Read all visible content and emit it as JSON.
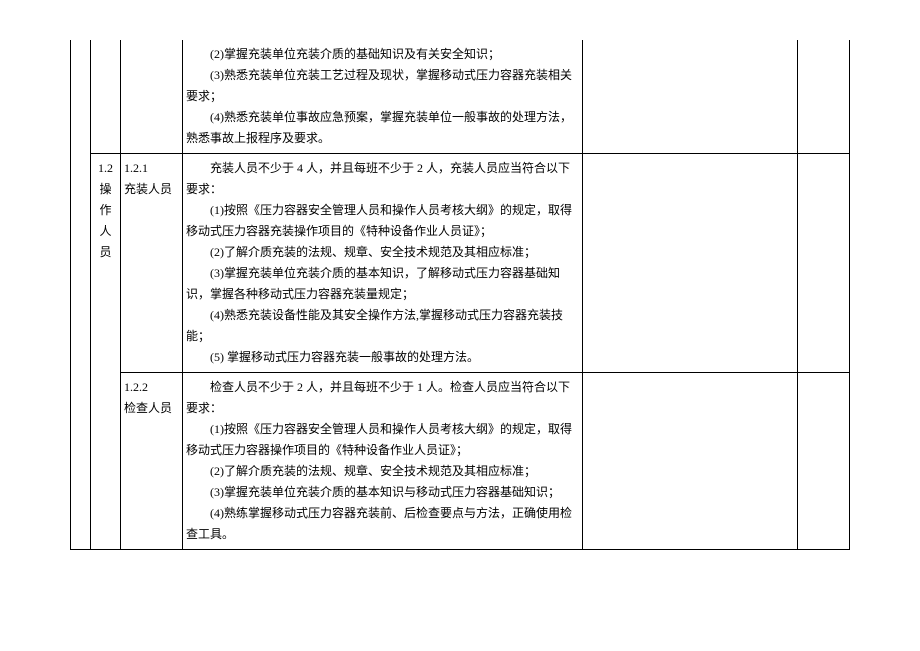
{
  "rows": {
    "r0": {
      "c3_p1": "(2)掌握充装单位充装介质的基础知识及有关安全知识；",
      "c3_p2": "(3)熟悉充装单位充装工艺过程及现状，掌握移动式压力容器充装相关要求；",
      "c3_p3": "(4)熟悉充装单位事故应急预案，掌握充装单位一般事故的处理方法，熟悉事故上报程序及要求。"
    },
    "r1": {
      "c1_l1": "1.2",
      "c1_l2": "操作人员",
      "c2_l1": "1.2.1",
      "c2_l2": "充装人员",
      "c3_p1": "充装人员不少于 4 人，并且每班不少于 2 人，充装人员应当符合以下要求：",
      "c3_p2": "(1)按照《压力容器安全管理人员和操作人员考核大纲》的规定，取得移动式压力容器充装操作项目的《特种设备作业人员证》；",
      "c3_p3": "(2)了解介质充装的法规、规章、安全技术规范及其相应标准；",
      "c3_p4": "(3)掌握充装单位充装介质的基本知识，了解移动式压力容器基础知识，掌握各种移动式压力容器充装量规定；",
      "c3_p5": "(4)熟悉充装设备性能及其安全操作方法,掌握移动式压力容器充装技能；",
      "c3_p6": "(5) 掌握移动式压力容器充装一般事故的处理方法。"
    },
    "r2": {
      "c2_l1": "1.2.2",
      "c2_l2": "检查人员",
      "c3_p1": "检查人员不少于 2 人，并且每班不少于 1 人。检查人员应当符合以下要求：",
      "c3_p2": "(1)按照《压力容器安全管理人员和操作人员考核大纲》的规定，取得移动式压力容器操作项目的《特种设备作业人员证》；",
      "c3_p3": "(2)了解介质充装的法规、规章、安全技术规范及其相应标准；",
      "c3_p4": "(3)掌握充装单位充装介质的基本知识与移动式压力容器基础知识；",
      "c3_p5": "(4)熟练掌握移动式压力容器充装前、后检查要点与方法，正确使用检查工具。"
    }
  }
}
